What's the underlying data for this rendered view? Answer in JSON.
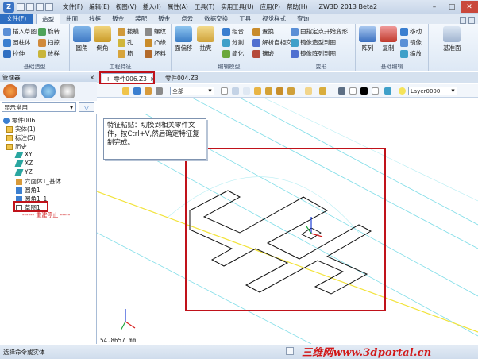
{
  "titlebar": {
    "menu": [
      "文件(F)",
      "编辑(E)",
      "视图(V)",
      "插入(I)",
      "属性(A)",
      "工具(T)",
      "实用工具(U)",
      "应用(P)",
      "帮助(H)"
    ],
    "app_title": "ZW3D 2013 Beta2"
  },
  "ribbon_tabs": {
    "file": "文件(F)",
    "tabs": [
      "造型",
      "曲面",
      "线框",
      "钣金",
      "装配",
      "钣金",
      "点云",
      "数据交换",
      "工具",
      "视觉样式",
      "查询"
    ],
    "active": "造型"
  },
  "ribbon": {
    "group_basic": {
      "label": "基础造型",
      "items": [
        "插入草图",
        "旋转",
        "圆柱体",
        "扫掠",
        "拉伸",
        "放样"
      ]
    },
    "group_feature": {
      "label": "工程特征",
      "big": [
        "圆角",
        "倒角"
      ],
      "items": [
        "拔模",
        "螺纹",
        "孔",
        "凸缘",
        "筋",
        "坯料"
      ]
    },
    "group_edit": {
      "label": "编辑模型",
      "big": [
        "面偏移",
        "抽壳"
      ],
      "items": [
        "组合",
        "置换",
        "分割",
        "解析自相交",
        "简化",
        "镶嵌"
      ]
    },
    "group_transform": {
      "label": "变形",
      "items": [
        "由指定点开始变形",
        "镜像造型到图",
        "镜像阵列到图"
      ]
    },
    "group_basic_edit": {
      "label": "基础编辑",
      "big": [
        "阵列",
        "复制"
      ],
      "items": [
        "移动",
        "镜像",
        "缩放"
      ]
    },
    "group_datum": {
      "label": "基准面"
    }
  },
  "manager": {
    "title": "管理器",
    "close": "×",
    "filter": "显示常用",
    "tree": {
      "root": "零件006",
      "entity": "实体(1)",
      "markup": "标注(5)",
      "history": "历史",
      "items": [
        "XY",
        "XZ",
        "YZ",
        "六面体1_基体",
        "圆角1",
        "圆角1_1",
        "草图1"
      ],
      "stop_label": "------ 重建停止 -----"
    }
  },
  "doc_tabs": {
    "add": "+",
    "active": "零件006.Z3",
    "close": "×",
    "other": "零件004.Z3"
  },
  "view_toolbar": {
    "filter_value": "全部",
    "layer_value": "Layer0000"
  },
  "note": {
    "text": "特征粘贴：切换到相关零件文件，按Ctrl+V,然后确定特征复制完成。"
  },
  "coord_readout": "54.8657 mm",
  "status": {
    "text": "选择命令或实体"
  },
  "watermark": "三维网www.3dportal.cn",
  "colors": {
    "accent": "#2f6fc2",
    "highlight_red": "#c0121a",
    "grid_cyan": "#7fdde8",
    "axis_yellow": "#f2e33a"
  }
}
